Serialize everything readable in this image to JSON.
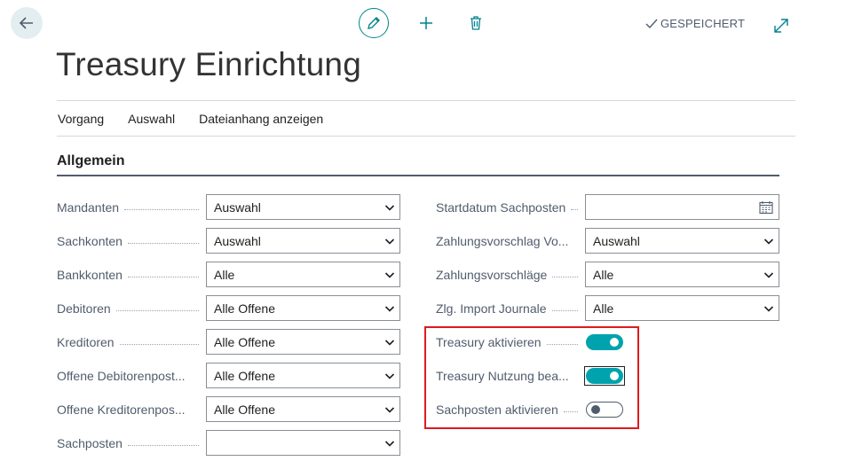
{
  "toolbar": {
    "saved_label": "GESPEICHERT",
    "icons": [
      "back-arrow-icon",
      "pencil-icon",
      "plus-icon",
      "trash-icon",
      "checkmark-icon",
      "expand-icon"
    ]
  },
  "page": {
    "title": "Treasury Einrichtung"
  },
  "actions": [
    "Vorgang",
    "Auswahl",
    "Dateianhang anzeigen"
  ],
  "section": {
    "title": "Allgemein"
  },
  "left_fields": [
    {
      "label": "Mandanten",
      "value": "Auswahl"
    },
    {
      "label": "Sachkonten",
      "value": "Auswahl"
    },
    {
      "label": "Bankkonten",
      "value": "Alle"
    },
    {
      "label": "Debitoren",
      "value": "Alle Offene"
    },
    {
      "label": "Kreditoren",
      "value": "Alle Offene"
    },
    {
      "label": "Offene Debitorenpost...",
      "value": "Alle Offene"
    },
    {
      "label": "Offene Kreditorenpos...",
      "value": "Alle Offene"
    },
    {
      "label": "Sachposten",
      "value": ""
    }
  ],
  "right_fields": [
    {
      "label": "Startdatum Sachposten",
      "value": ""
    },
    {
      "label": "Zahlungsvorschlag Vo...",
      "value": "Auswahl"
    },
    {
      "label": "Zahlungsvorschläge",
      "value": "Alle"
    },
    {
      "label": "Zlg. Import Journale",
      "value": "Alle"
    }
  ],
  "toggles": [
    {
      "label": "Treasury aktivieren",
      "checked": true
    },
    {
      "label": "Treasury Nutzung bea...",
      "checked": true
    },
    {
      "label": "Sachposten aktivieren",
      "checked": false
    }
  ],
  "colors": {
    "accent": "#00a3ad",
    "highlight_border": "#e01b1b",
    "label_text": "#505c6d"
  }
}
